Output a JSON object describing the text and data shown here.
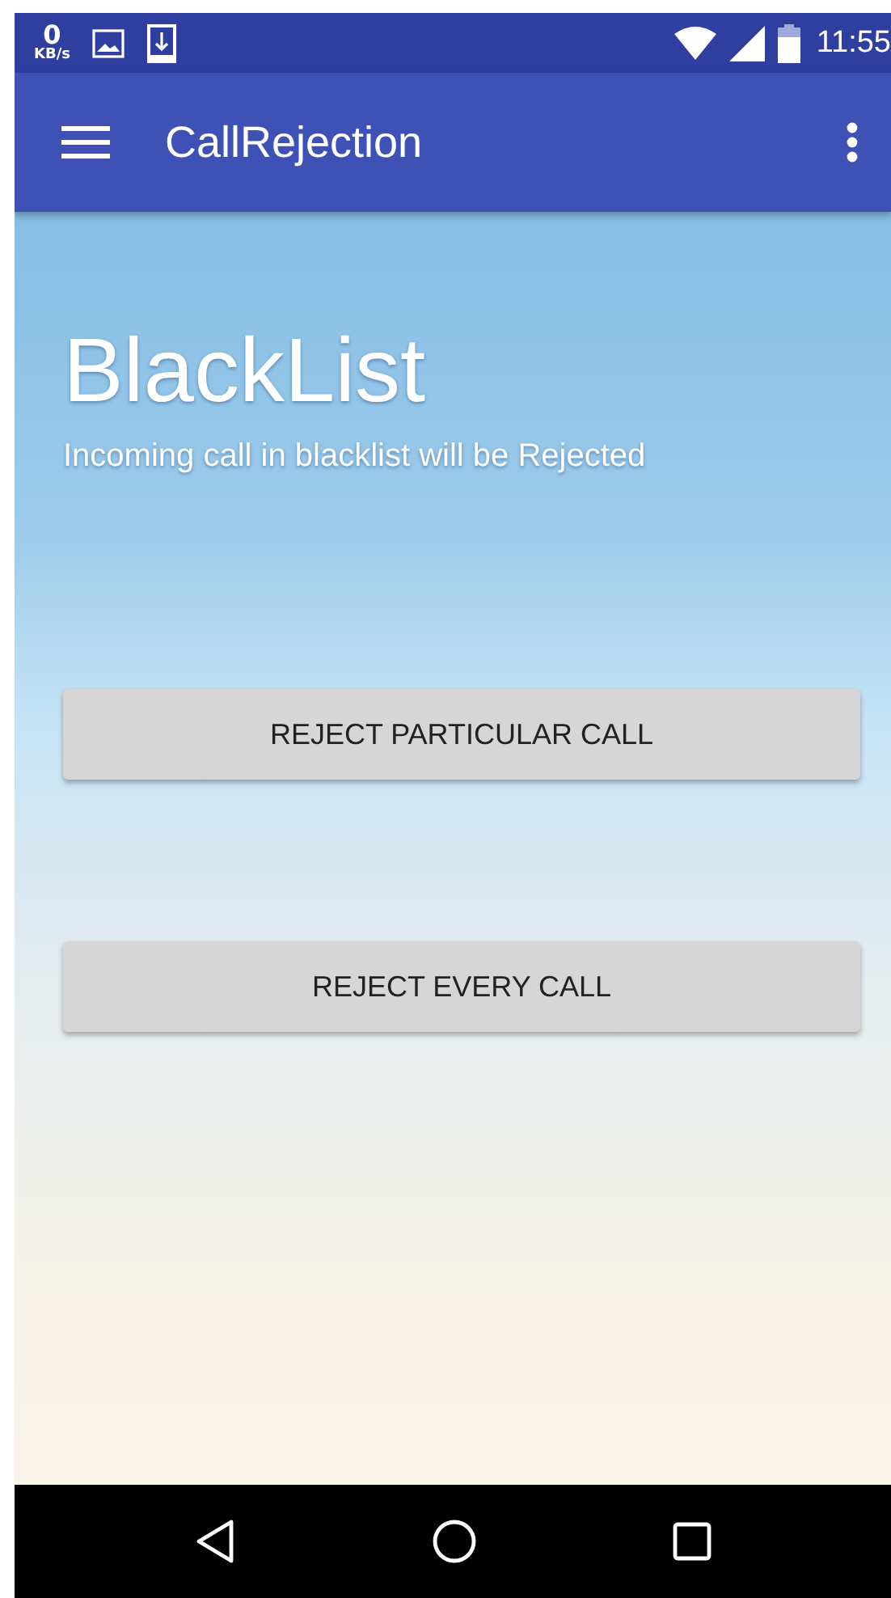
{
  "status_bar": {
    "speed_value": "0",
    "speed_unit": "KB/s",
    "time": "11:55"
  },
  "app_bar": {
    "title": "CallRejection"
  },
  "header": {
    "title": "BlackList",
    "subtitle": "Incoming call in blacklist will be Rejected"
  },
  "buttons": [
    "REJECT PARTICULAR CALL",
    "REJECT EVERY CALL"
  ]
}
